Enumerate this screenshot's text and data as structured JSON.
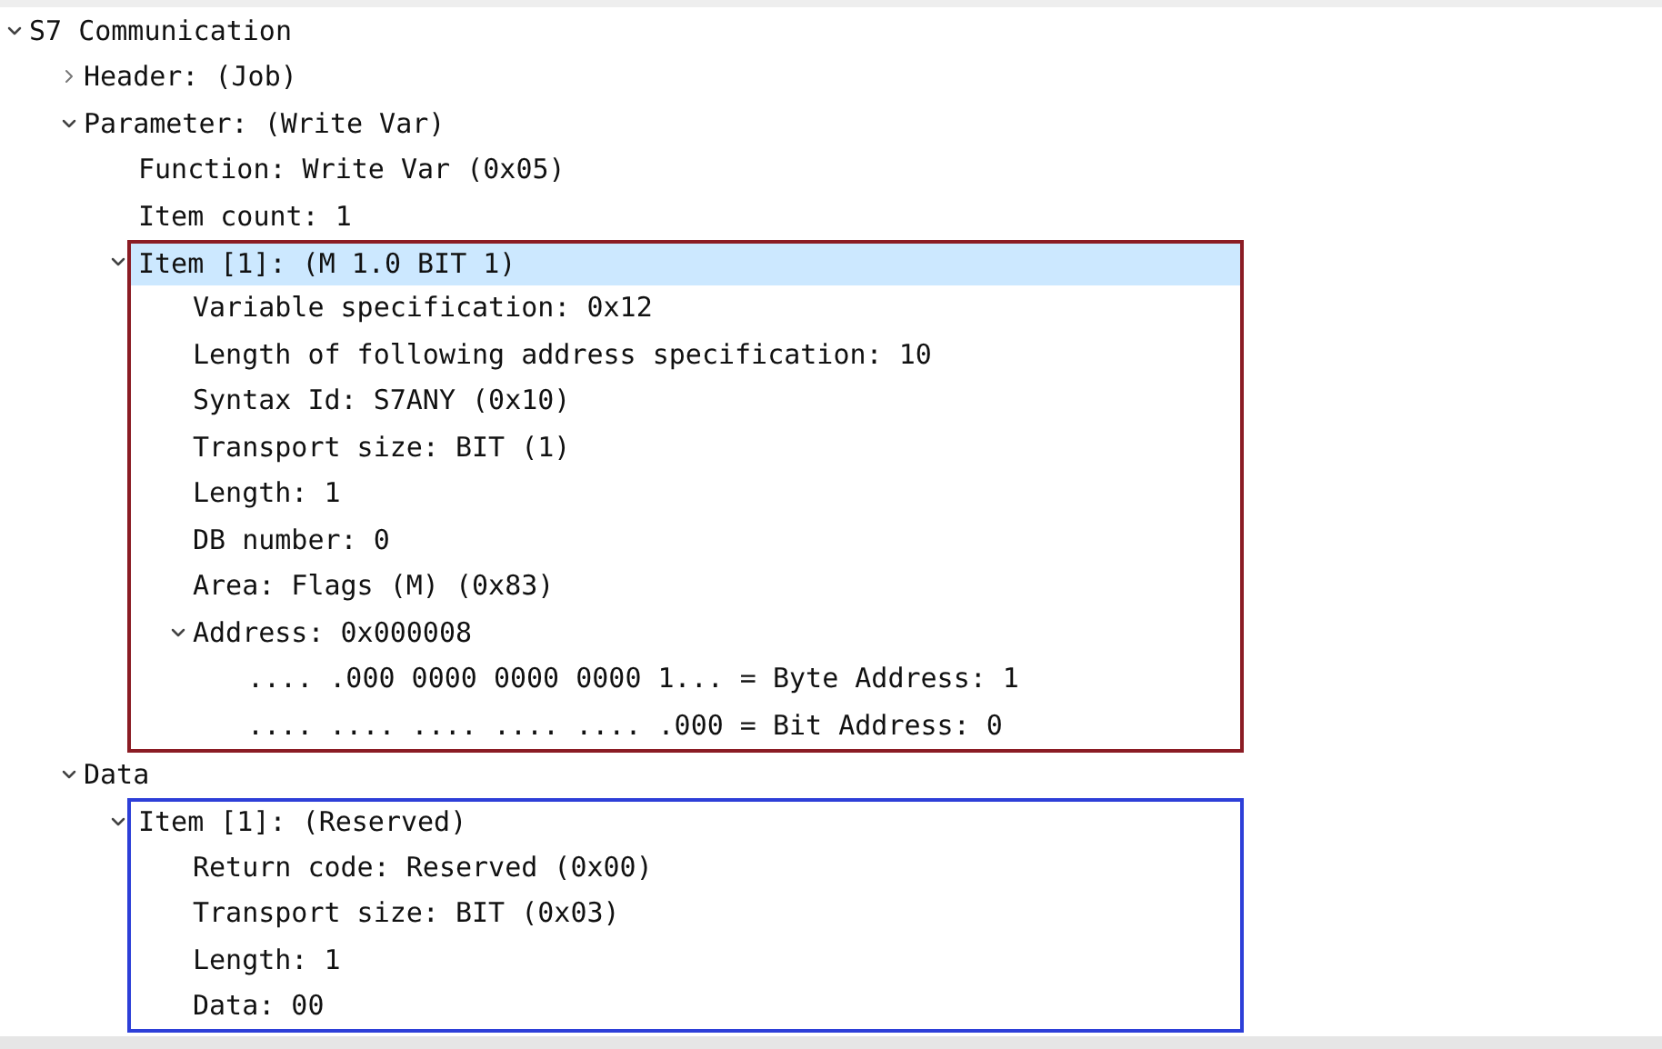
{
  "tree": [
    {
      "label": "S7 Communication",
      "expanded": true,
      "selected": false,
      "children": [
        {
          "label": "Header: (Job)",
          "expanded": false,
          "selected": false
        },
        {
          "label": "Parameter: (Write Var)",
          "expanded": true,
          "selected": false,
          "children": [
            {
              "label": "Function: Write Var (0x05)",
              "selected": false
            },
            {
              "label": "Item count: 1",
              "selected": false
            },
            {
              "label": "Item [1]: (M 1.0 BIT 1)",
              "expanded": true,
              "selected": true,
              "color": "#8b1c24",
              "children": [
                {
                  "label": "Variable specification: 0x12",
                  "selected": false
                },
                {
                  "label": "Length of following address specification: 10",
                  "selected": false
                },
                {
                  "label": "Syntax Id: S7ANY (0x10)",
                  "selected": false
                },
                {
                  "label": "Transport size: BIT (1)",
                  "selected": false
                },
                {
                  "label": "Length: 1",
                  "selected": false
                },
                {
                  "label": "DB number: 0",
                  "selected": false
                },
                {
                  "label": "Area: Flags (M) (0x83)",
                  "selected": false
                },
                {
                  "label": "Address: 0x000008",
                  "expanded": true,
                  "selected": false,
                  "children": [
                    {
                      "label": ".... .000 0000 0000 0000 1... = Byte Address: 1",
                      "selected": false
                    },
                    {
                      "label": ".... .... .... .... .... .000 = Bit Address: 0",
                      "selected": false
                    }
                  ]
                }
              ]
            }
          ]
        },
        {
          "label": "Data",
          "expanded": true,
          "selected": false,
          "children": [
            {
              "label": "Item [1]: (Reserved)",
              "expanded": true,
              "selected": false,
              "color": "#2d3fd8",
              "children": [
                {
                  "label": "Return code: Reserved (0x00)",
                  "selected": false
                },
                {
                  "label": "Transport size: BIT (0x03)",
                  "selected": false
                },
                {
                  "label": "Length: 1",
                  "selected": false
                },
                {
                  "label": "Data: 00",
                  "selected": false
                }
              ]
            }
          ]
        }
      ]
    }
  ]
}
